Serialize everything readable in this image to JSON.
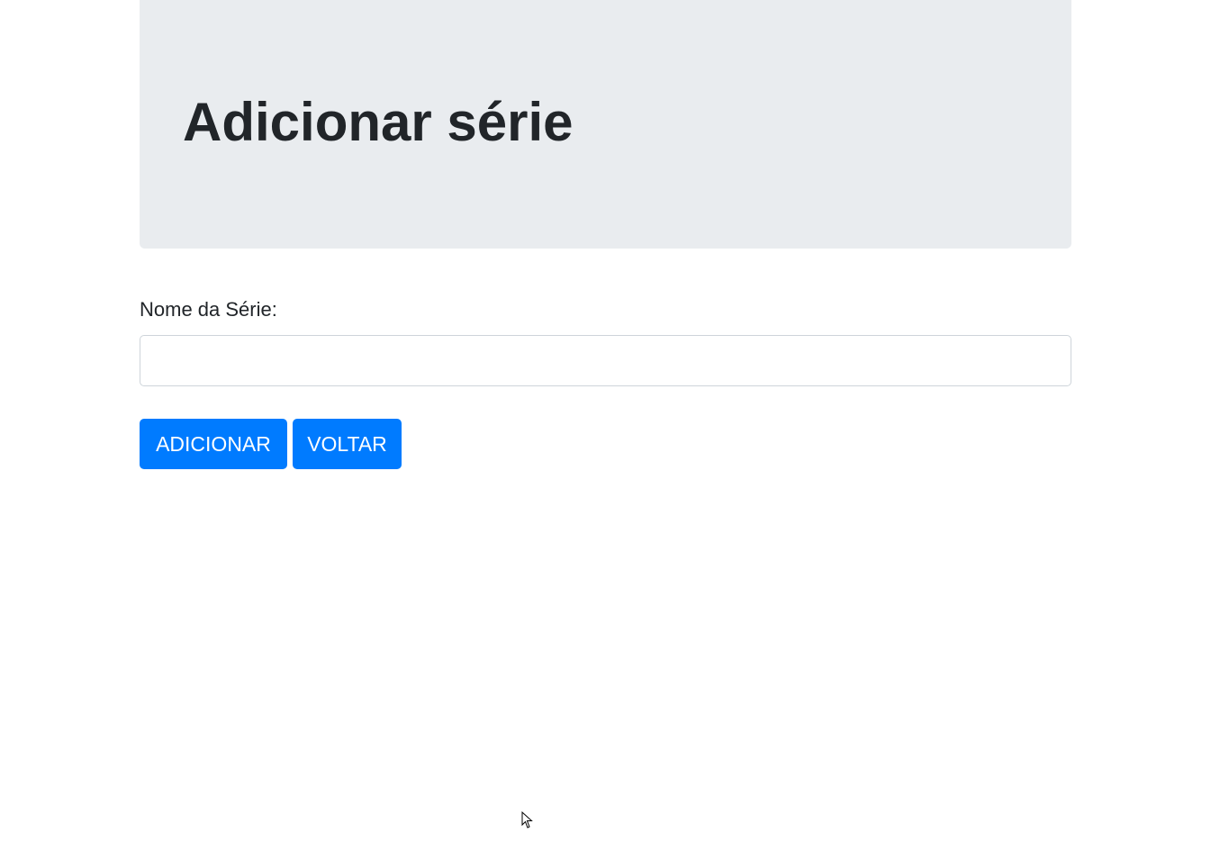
{
  "header": {
    "title": "Adicionar série"
  },
  "form": {
    "name_label": "Nome da Série:",
    "name_value": "",
    "name_placeholder": ""
  },
  "actions": {
    "add_label": "ADICIONAR",
    "back_label": "VOLTAR"
  },
  "colors": {
    "jumbotron_bg": "#e9ecef",
    "primary": "#007bff",
    "text": "#212529"
  },
  "icons": {
    "cursor": "mouse-pointer-icon"
  }
}
